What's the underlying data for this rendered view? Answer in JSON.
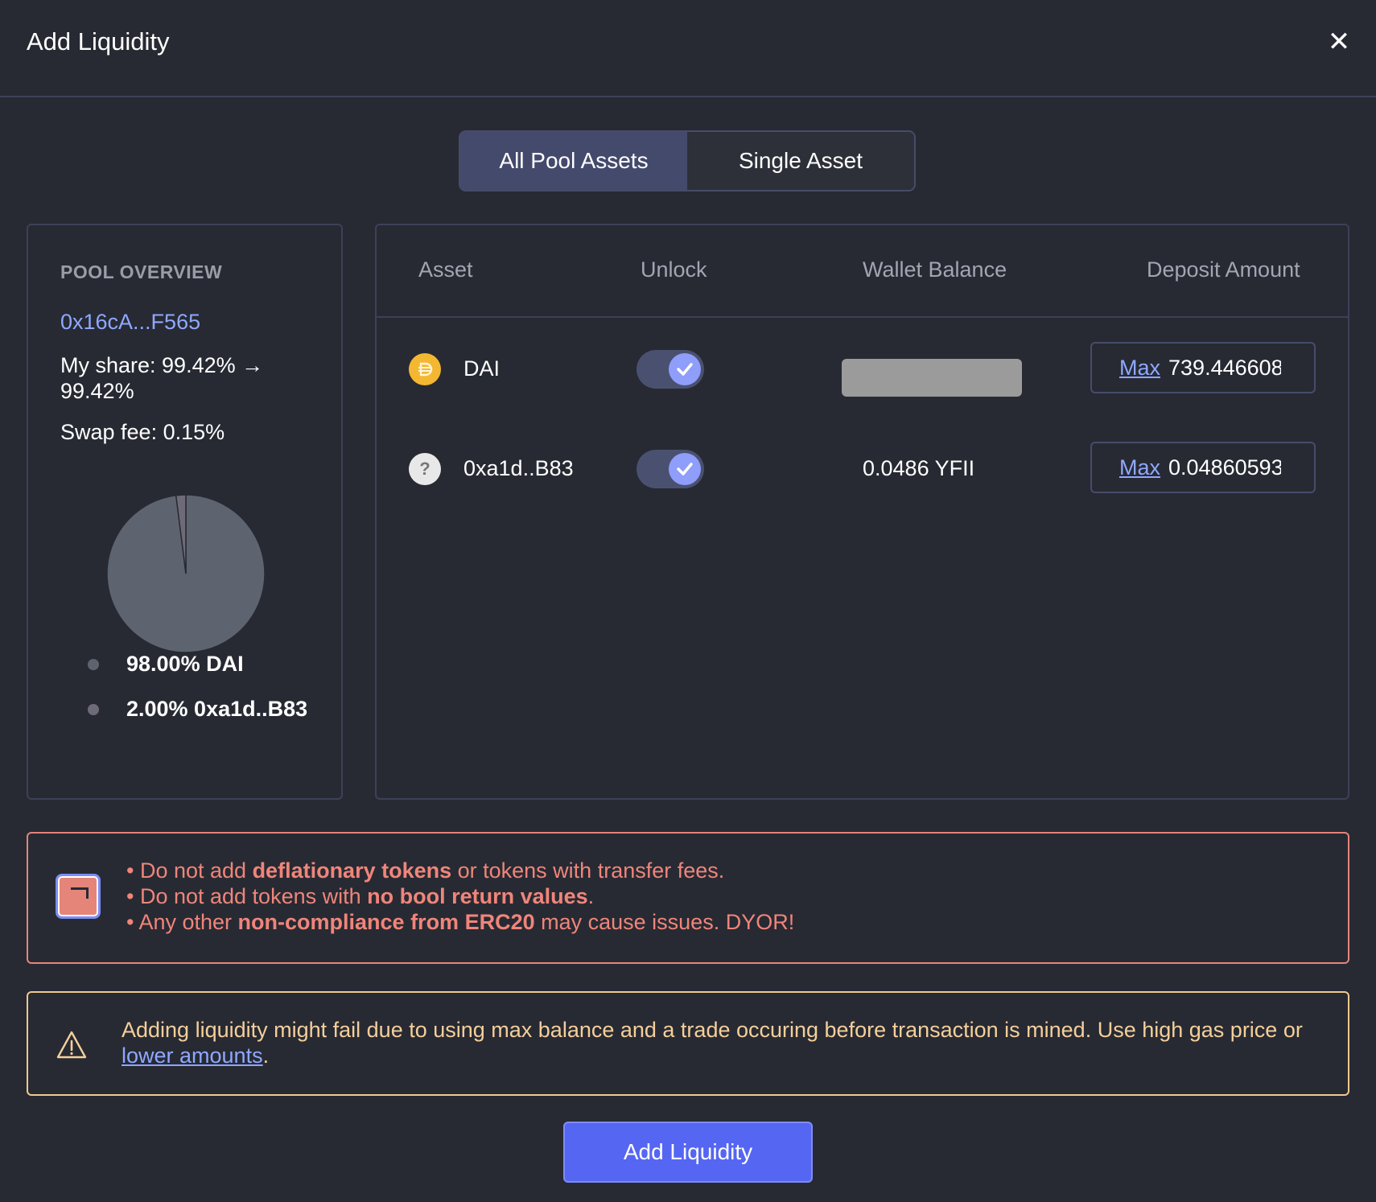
{
  "header": {
    "title": "Add Liquidity",
    "close_icon": "close-icon"
  },
  "tabs": [
    {
      "label": "All Pool Assets",
      "active": true
    },
    {
      "label": "Single Asset",
      "active": false
    }
  ],
  "pool_overview": {
    "heading": "POOL OVERVIEW",
    "address": "0x16cA...F565",
    "my_share": "My share: 99.42% → 99.42%",
    "swap_fee": "Swap fee: 0.15%",
    "legend": [
      {
        "label": "98.00% DAI",
        "color": "#5d6470"
      },
      {
        "label": "2.00% 0xa1d..B83",
        "color": "#6f6a78"
      }
    ]
  },
  "chart_data": {
    "type": "pie",
    "categories": [
      "DAI",
      "0xa1d..B83"
    ],
    "values": [
      98.0,
      2.0
    ],
    "colors": [
      "#5d6470",
      "#6f6a78"
    ]
  },
  "assets_table": {
    "columns": [
      "Asset",
      "Unlock",
      "Wallet Balance",
      "Deposit Amount"
    ],
    "rows": [
      {
        "asset": "DAI",
        "icon": "dai-icon",
        "icon_color": "#f4b731",
        "unlocked": true,
        "wallet_balance": "",
        "balance_hidden": true,
        "max_label": "Max",
        "deposit_amount": "739.446608"
      },
      {
        "asset": "0xa1d..B83",
        "icon": "unknown-token-icon",
        "icon_color": "#e8e8e8",
        "unlocked": true,
        "wallet_balance": "0.0486 YFII",
        "balance_hidden": false,
        "max_label": "Max",
        "deposit_amount": "0.04860593"
      }
    ]
  },
  "red_notice": {
    "lines": [
      {
        "pre": "• Do not add ",
        "bold": "deflationary tokens",
        "post": " or tokens with transfer fees."
      },
      {
        "pre": "• Do not add tokens with ",
        "bold": "no bool return values",
        "post": "."
      },
      {
        "pre": "• Any other ",
        "bold": "non-compliance from ERC20",
        "post": " may cause issues. DYOR!"
      }
    ],
    "color": "#e5857a"
  },
  "yellow_notice": {
    "text": "Adding liquidity might fail due to using max balance and a trade occuring before transaction is mined. Use high gas price or ",
    "link": "lower amounts",
    "suffix": ".",
    "color": "#f2c98d"
  },
  "add_button": {
    "label": "Add Liquidity"
  },
  "colors": {
    "accent": "#5566f2",
    "link": "#8fa8ff",
    "background": "#272a33"
  }
}
